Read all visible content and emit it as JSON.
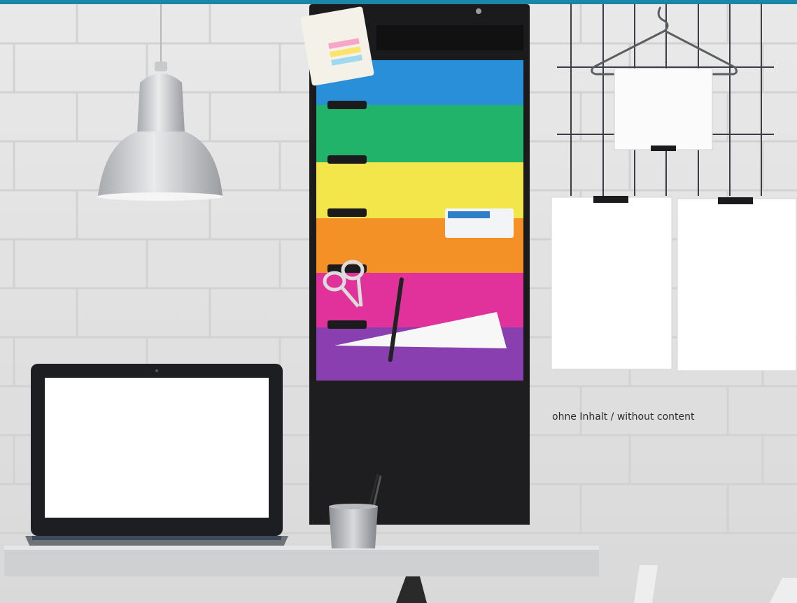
{
  "caption": "ohne Inhalt / without content",
  "colors": {
    "top_bar": "#1c86a6",
    "wall": "#e6e6e6",
    "organizer_frame": "#1b1b1d",
    "pocket_blue": "#2a8fd9",
    "pocket_green": "#22b36a",
    "pocket_yellow": "#f2e64a",
    "pocket_orange": "#f39126",
    "pocket_pink": "#e0329a",
    "pocket_purple": "#8a3fb0"
  },
  "icons": [
    "desk-lamp-icon",
    "wall-organizer-icon",
    "laptop-icon",
    "pen-cup-icon",
    "wire-grid-icon",
    "hanger-icon",
    "paper-sheet-icon",
    "scissors-icon",
    "pen-icon"
  ]
}
